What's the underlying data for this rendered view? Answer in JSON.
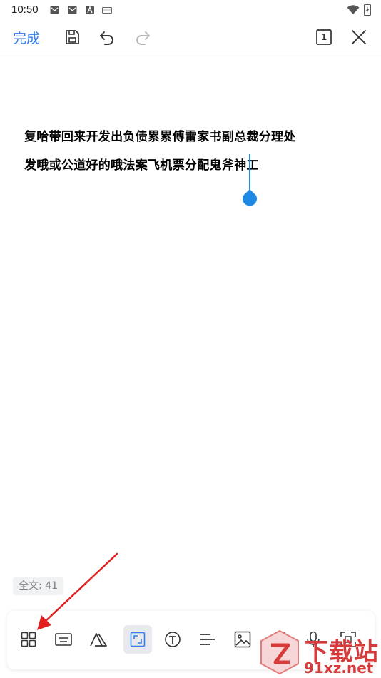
{
  "status_bar": {
    "time": "10:50"
  },
  "toolbar": {
    "done_label": "完成",
    "page_number": "1"
  },
  "document": {
    "lines": [
      "复哈带回来开发出负债累累傅雷家书副总裁分理处",
      "发哦或公道好的哦法案飞机票分配鬼斧神工"
    ]
  },
  "word_count": "全文: 41",
  "watermark": {
    "top_text": "下载站",
    "bottom_text": "91xz.net"
  },
  "colors": {
    "accent": "#2f7cf6",
    "caret": "#1e88e5",
    "annotation_arrow": "#e02020",
    "watermark": "#d63b3b"
  },
  "icons": {
    "toolbar": [
      "save-icon",
      "undo-icon",
      "redo-icon",
      "page-count-icon",
      "close-icon"
    ],
    "bottom": [
      "apps-icon",
      "keyboard-icon",
      "font-style-icon",
      "select-region-icon",
      "text-icon",
      "align-icon",
      "image-icon",
      "shapes-icon",
      "microphone-icon",
      "scan-icon"
    ]
  }
}
